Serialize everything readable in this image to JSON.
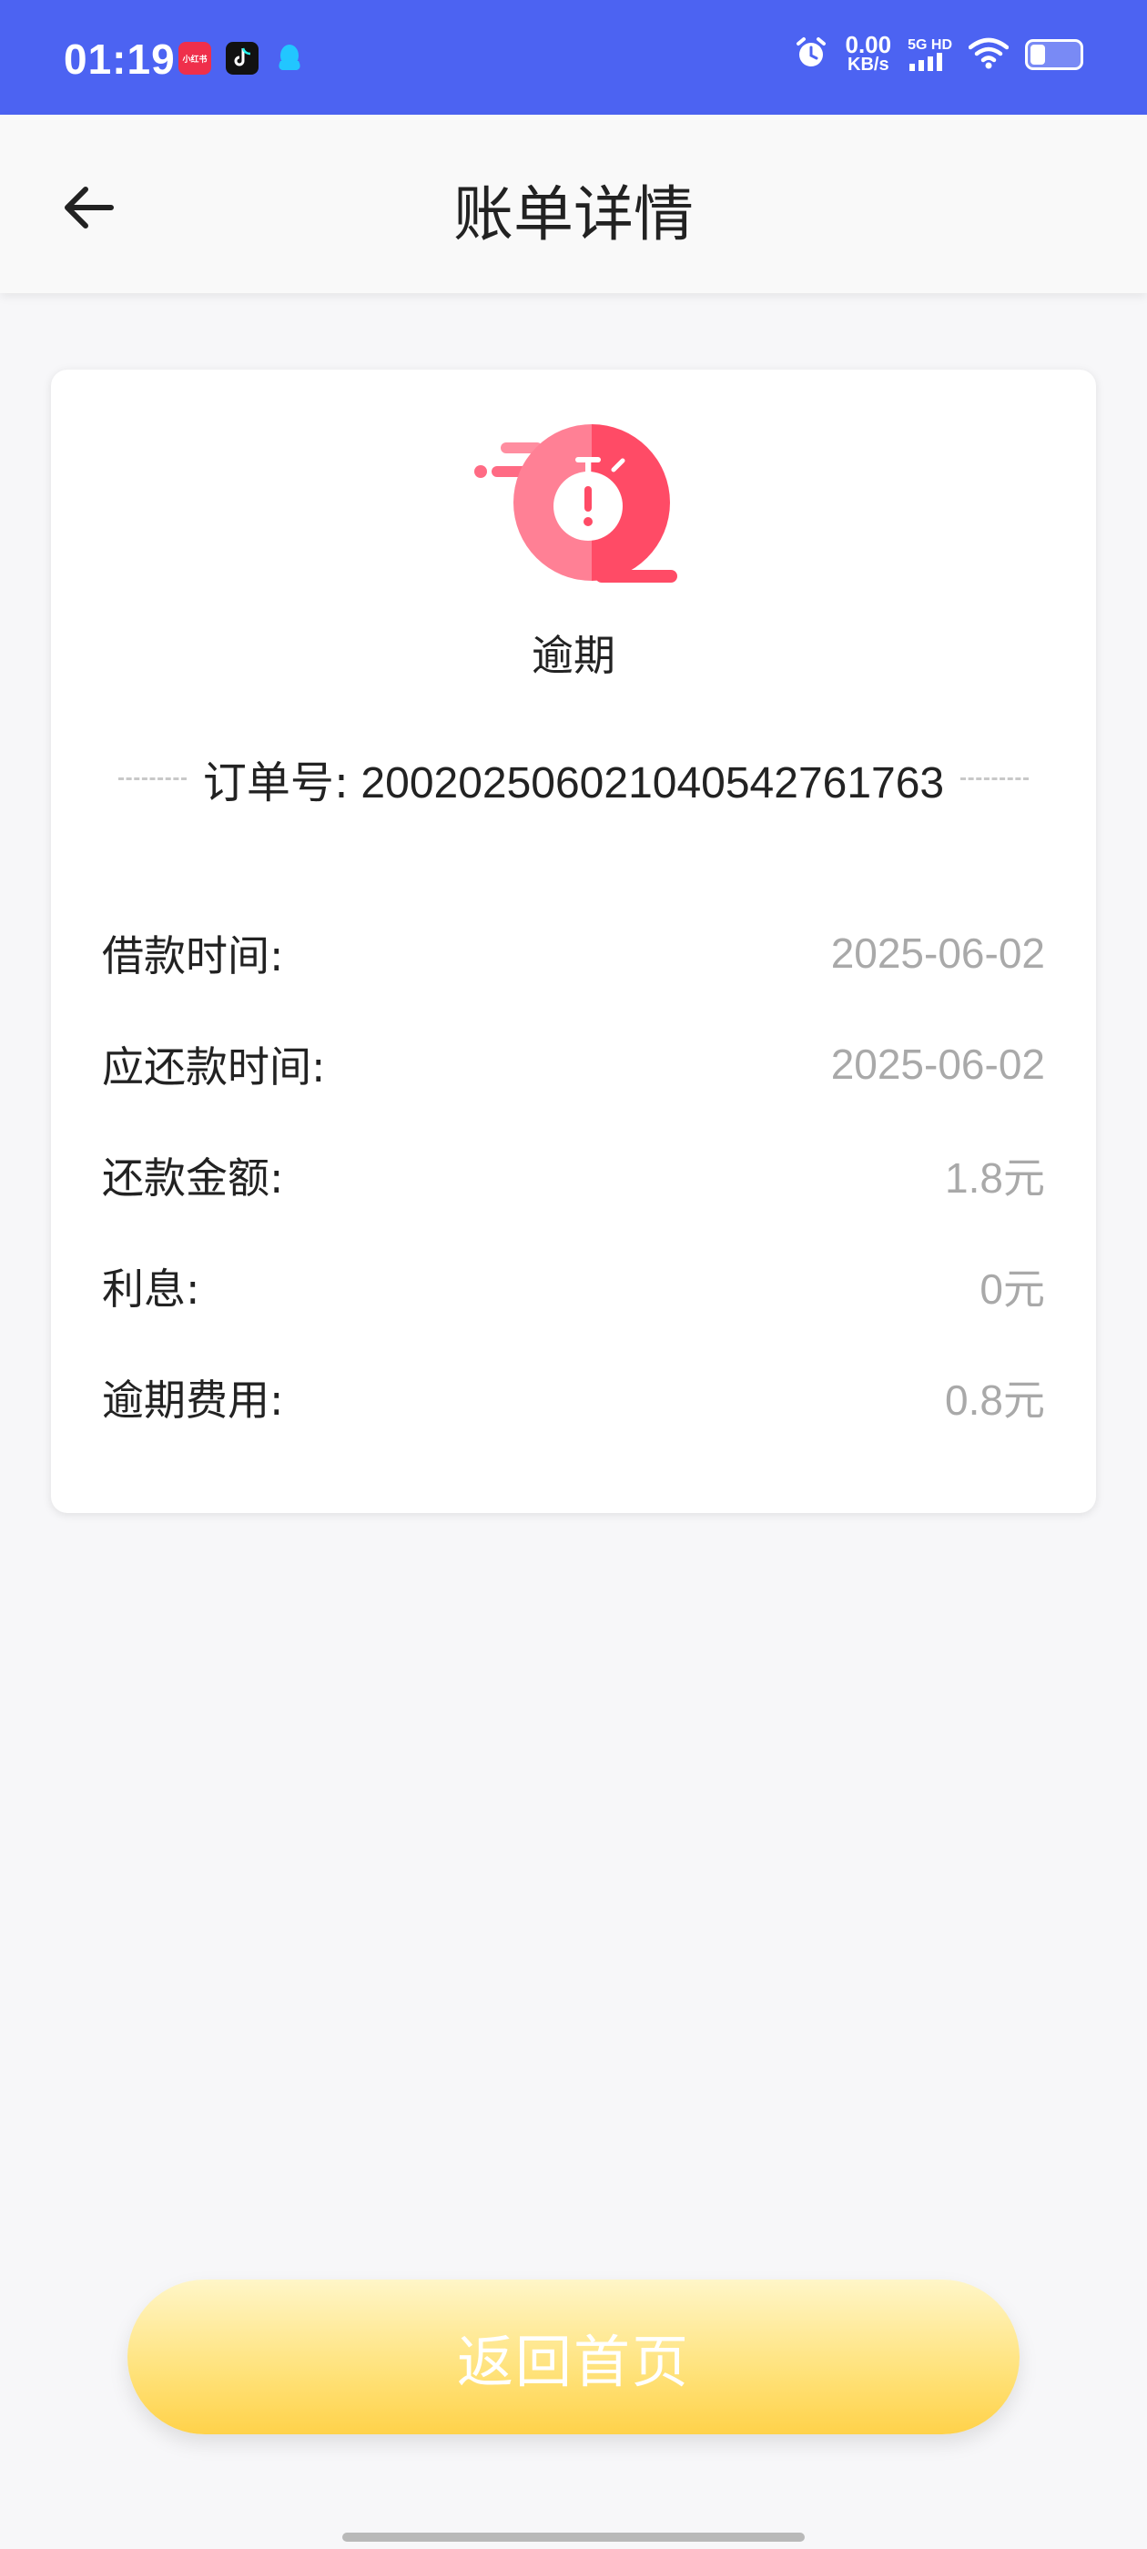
{
  "status_bar": {
    "time": "01:19",
    "apps": [
      "小红书",
      "douyin-icon",
      "qq-icon"
    ],
    "net_speed_value": "0.00",
    "net_speed_unit": "KB/s",
    "signal_label": "5G HD",
    "battery_level": 0.3,
    "background_color": "#4c63f2"
  },
  "header": {
    "title": "账单详情",
    "back_icon": "arrow-left-icon"
  },
  "bill": {
    "status_icon": "overdue-stopwatch-icon",
    "status_text": "逾期",
    "order_label": "订单号:",
    "order_number": "200202506021040542761763",
    "rows": [
      {
        "label": "借款时间:",
        "value": "2025-06-02"
      },
      {
        "label": "应还款时间:",
        "value": "2025-06-02"
      },
      {
        "label": "还款金额:",
        "value": "1.8元"
      },
      {
        "label": "利息:",
        "value": "0元"
      },
      {
        "label": "逾期费用:",
        "value": "0.8元"
      }
    ]
  },
  "footer": {
    "home_button_label": "返回首页",
    "button_color": "#ffe27a"
  }
}
